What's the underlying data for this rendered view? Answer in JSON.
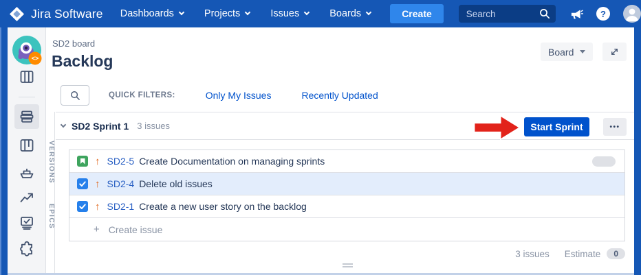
{
  "colors": {
    "navbar_blue": "#1557B5",
    "create_button": "#2F86EB",
    "search_bg": "#0B3D85",
    "start_sprint": "#0052CC",
    "link_blue": "#0052CC",
    "selected_row": "#E3EDFC",
    "story_green": "#3EA45E",
    "checkbox_blue": "#2680EB",
    "priority_orange": "#E0691F",
    "arrow_red": "#E2231A"
  },
  "navbar": {
    "logo_text": "Jira Software",
    "menu": [
      {
        "label": "Dashboards"
      },
      {
        "label": "Projects"
      },
      {
        "label": "Issues"
      },
      {
        "label": "Boards"
      }
    ],
    "create_label": "Create",
    "search_placeholder": "Search",
    "help_glyph": "?"
  },
  "sidebar": {
    "items": [
      {
        "icon": "project-avatar"
      },
      {
        "icon": "board-icon"
      },
      {
        "icon": "backlog-icon",
        "selected": true
      },
      {
        "icon": "active-sprints-icon"
      },
      {
        "icon": "releases-icon"
      },
      {
        "icon": "reports-icon"
      },
      {
        "icon": "issues-icon"
      },
      {
        "icon": "addons-icon"
      }
    ]
  },
  "rail": {
    "tabs": [
      {
        "label": "VERSIONS"
      },
      {
        "label": "EPICS"
      }
    ]
  },
  "header": {
    "breadcrumb": "SD2 board",
    "title": "Backlog",
    "board_button_label": "Board"
  },
  "filters": {
    "label": "QUICK FILTERS:",
    "links": [
      {
        "label": "Only My Issues"
      },
      {
        "label": "Recently Updated"
      }
    ]
  },
  "sprint": {
    "name": "SD2 Sprint 1",
    "count": "3 issues",
    "start_button_label": "Start Sprint",
    "ellipsis": "•••",
    "issues": [
      {
        "key": "SD2-5",
        "summary": "Create Documentation on managing sprints",
        "type": "story",
        "priority": "high",
        "selected": false,
        "estimate_pill": true
      },
      {
        "key": "SD2-4",
        "summary": "Delete old issues",
        "type": "checked",
        "priority": "high",
        "selected": true,
        "estimate_pill": false
      },
      {
        "key": "SD2-1",
        "summary": "Create a new user story on the backlog",
        "type": "checked",
        "priority": "high",
        "selected": false,
        "estimate_pill": false
      }
    ],
    "create_issue": {
      "plus": "+",
      "label": "Create issue"
    }
  },
  "footer": {
    "count": "3 issues",
    "estimate_label": "Estimate",
    "estimate_value": "0"
  }
}
